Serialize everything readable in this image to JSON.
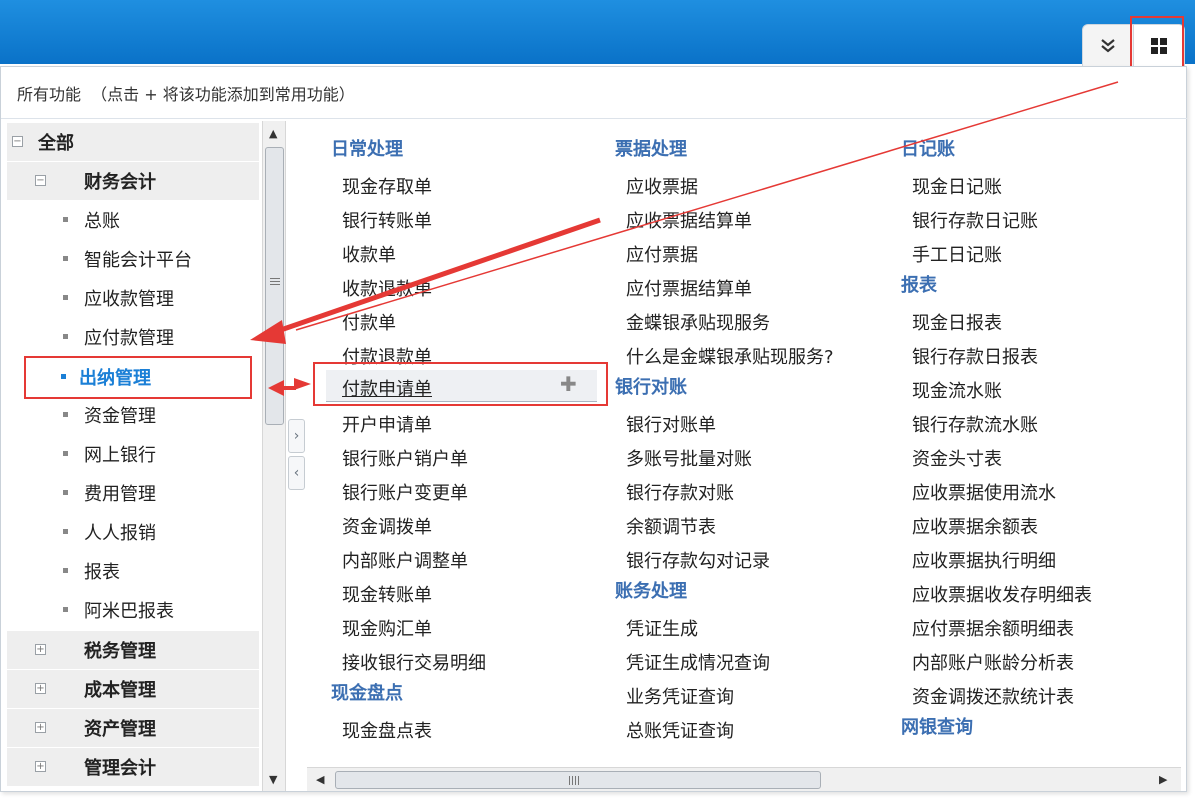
{
  "toolbar": {
    "expand_icon": "double-chevron-down-icon",
    "grid_icon": "grid-icon"
  },
  "panel": {
    "header": "所有功能  （点击 + 将该功能添加到常用功能）"
  },
  "tree": {
    "root": "全部",
    "finance": "财务会计",
    "finance_children": [
      "总账",
      "智能会计平台",
      "应收款管理",
      "应付款管理",
      "出纳管理",
      "资金管理",
      "网上银行",
      "费用管理",
      "人人报销",
      "报表",
      "阿米巴报表"
    ],
    "collapsed_groups": [
      "税务管理",
      "成本管理",
      "资产管理",
      "管理会计"
    ],
    "selected": "出纳管理"
  },
  "content": {
    "col1": {
      "sections": [
        {
          "title": "日常处理",
          "items": [
            "现金存取单",
            "银行转账单",
            "收款单",
            "收款退款单",
            "付款单",
            "付款退款单",
            "付款申请单",
            "开户申请单",
            "银行账户销户单",
            "银行账户变更单",
            "资金调拨单",
            "内部账户调整单",
            "现金转账单",
            "现金购汇单",
            "接收银行交易明细"
          ]
        },
        {
          "title": "现金盘点",
          "items": [
            "现金盘点表"
          ]
        }
      ]
    },
    "col2": {
      "sections": [
        {
          "title": "票据处理",
          "items": [
            "应收票据",
            "应收票据结算单",
            "应付票据",
            "应付票据结算单",
            "金蝶银承贴现服务",
            "什么是金蝶银承贴现服务?"
          ]
        },
        {
          "title": "银行对账",
          "items": [
            "银行对账单",
            "多账号批量对账",
            "银行存款对账",
            "余额调节表",
            "银行存款勾对记录"
          ]
        },
        {
          "title": "账务处理",
          "items": [
            "凭证生成",
            "凭证生成情况查询",
            "业务凭证查询",
            "总账凭证查询"
          ]
        }
      ]
    },
    "col3": {
      "sections": [
        {
          "title": "日记账",
          "items": [
            "现金日记账",
            "银行存款日记账",
            "手工日记账"
          ]
        },
        {
          "title": "报表",
          "items": [
            "现金日报表",
            "银行存款日报表",
            "现金流水账",
            "银行存款流水账",
            "资金头寸表",
            "应收票据使用流水",
            "应收票据余额表",
            "应收票据执行明细",
            "应收票据收发存明细表",
            "应付票据余额明细表",
            "内部账户账龄分析表",
            "资金调拨还款统计表"
          ]
        },
        {
          "title": "网银查询",
          "items": []
        }
      ]
    },
    "hovered_item": "付款申请单",
    "add_icon": "plus-icon"
  },
  "colors": {
    "accent": "#1a7fd6",
    "section_title": "#3c6fb2",
    "highlight": "#e53935",
    "topbar": "#0a72c8"
  }
}
